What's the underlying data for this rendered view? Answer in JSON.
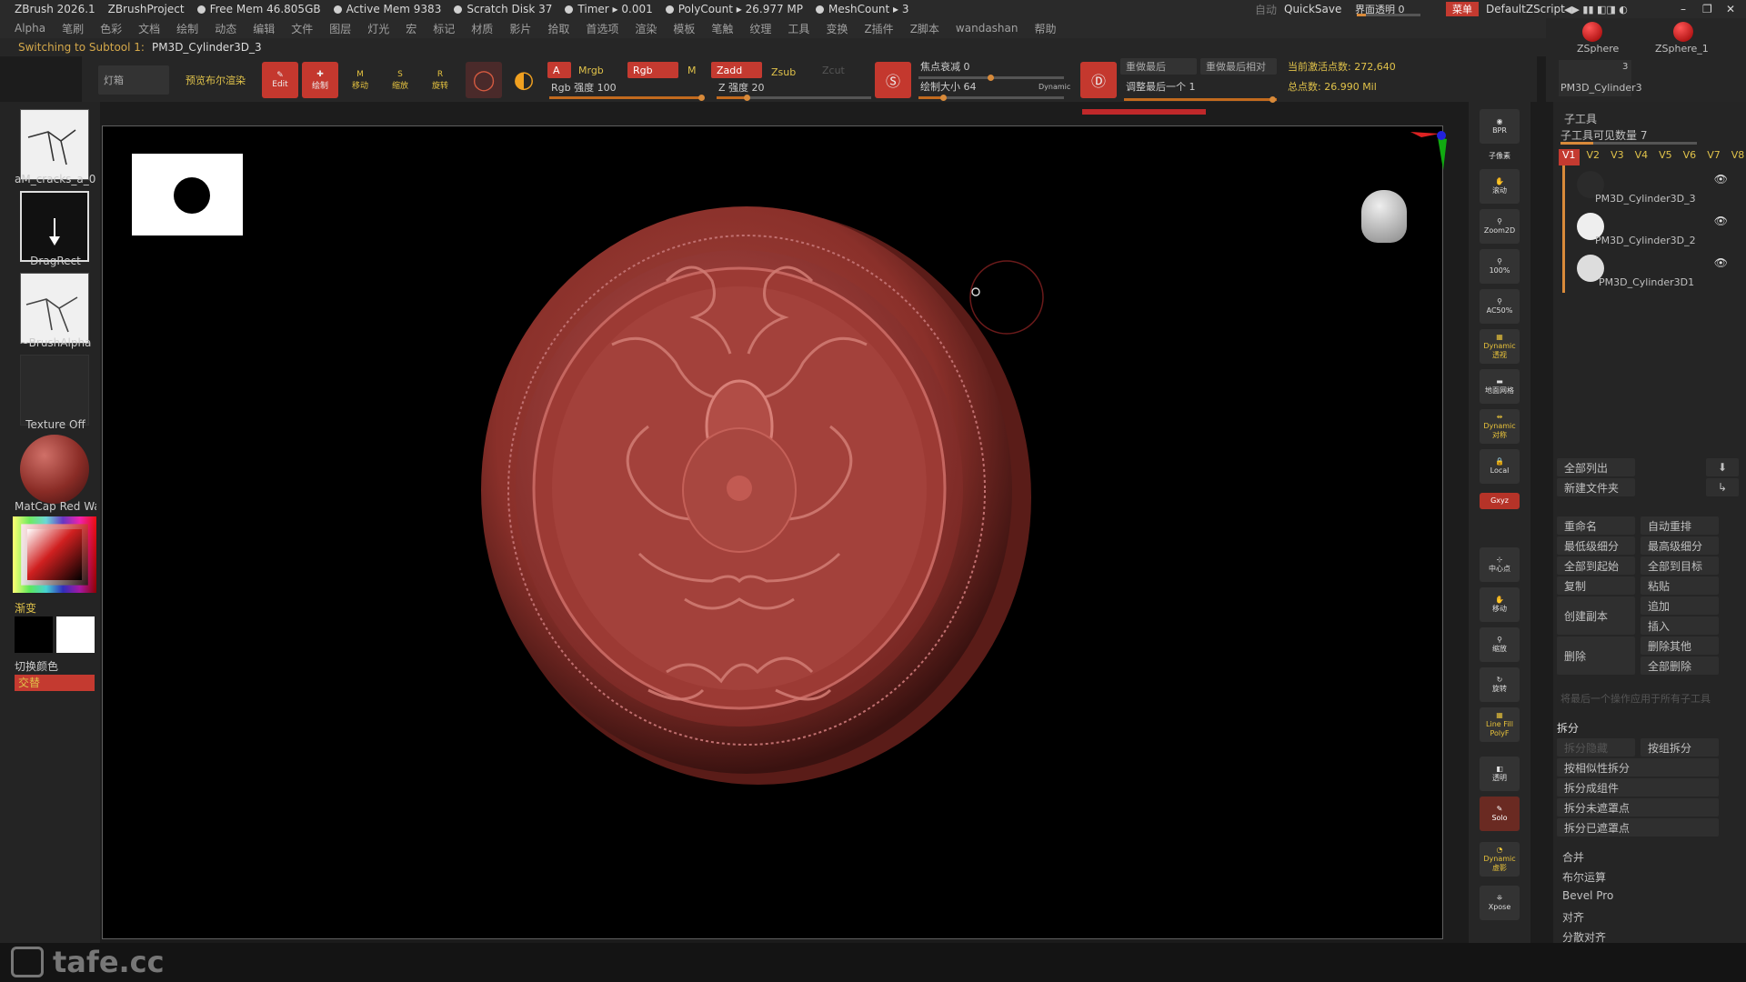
{
  "titlebar": {
    "app": "ZBrush 2026.1",
    "project": "ZBrushProject",
    "free_mem": "Free Mem 46.805GB",
    "active_mem": "Active Mem 9383",
    "scratch": "Scratch Disk 37",
    "timer": "Timer ▸ 0.001",
    "polycount": "PolyCount ▸ 26.977 MP",
    "meshcount": "MeshCount ▸ 3",
    "auto": "自动",
    "quicksave": "QuickSave",
    "ui_opacity": "界面透明 0",
    "menus_btn": "菜单",
    "script": "DefaultZScript"
  },
  "menus": [
    "Alpha",
    "笔刷",
    "色彩",
    "文档",
    "绘制",
    "动态",
    "编辑",
    "文件",
    "图层",
    "灯光",
    "宏",
    "标记",
    "材质",
    "影片",
    "拾取",
    "首选项",
    "渲染",
    "模板",
    "笔触",
    "纹理",
    "工具",
    "变换",
    "Z插件",
    "Z脚本",
    "wandashan",
    "帮助"
  ],
  "notice": {
    "label": "Switching to Subtool 1:",
    "subtool": "PM3D_Cylinder3D_3"
  },
  "toolbar": {
    "lightbox": "灯箱",
    "preview_bpr": "预览布尔渲染",
    "edit": "Edit",
    "draw": "绘制",
    "move": "移动",
    "scale": "缩放",
    "rotate": "旋转",
    "a": "A",
    "mrgb": "Mrgb",
    "rgb": "Rgb",
    "m": "M",
    "zadd": "Zadd",
    "zsub": "Zsub",
    "zcut": "Zcut",
    "rgb_intensity": "Rgb 强度 100",
    "z_intensity": "Z 强度 20",
    "focal_shift": "焦点衰减 0",
    "draw_size": "绘制大小 64",
    "dynamic": "Dynamic",
    "redo_last": "重做最后",
    "redo_last_rel": "重做最后相对",
    "adjust_last": "调整最后一个 1",
    "active_points": "当前激活点数: 272,640",
    "total_points": "总点数: 26.990 Mil"
  },
  "leftshelf": {
    "brush_alpha": "aM_cracks_a_0",
    "stroke": "DragRect",
    "alpha": "~BrushAlpha",
    "texture": "Texture Off",
    "material": "MatCap Red Wax",
    "gradient": "渐变",
    "switch_color": "切换颜色",
    "alternate": "交替"
  },
  "rightshelf": [
    "BPR",
    "子像素",
    "滚动",
    "Zoom2D",
    "100%",
    "AC50%",
    "Dynamic 透视",
    "地面网格",
    "Dynamic 对称",
    "Local",
    "Gxyz",
    "中心点",
    "移动",
    "缩放",
    "旋转",
    "Line Fill PolyF",
    "透明",
    "Solo",
    "Dynamic 虚影",
    "Xpose"
  ],
  "tool": {
    "zsphere": "ZSphere",
    "zsphere1": "ZSphere_1",
    "count": "3",
    "current": "PM3D_Cylinder3"
  },
  "subtool": {
    "title": "子工具",
    "visible_count": "子工具可见数量 7",
    "versions": [
      "V1",
      "V2",
      "V3",
      "V4",
      "V5",
      "V6",
      "V7",
      "V8"
    ],
    "items": [
      "PM3D_Cylinder3D_3",
      "PM3D_Cylinder3D_2",
      "PM3D_Cylinder3D1"
    ]
  },
  "palette": {
    "list_all": "全部列出",
    "new_folder": "新建文件夹",
    "rename": "重命名",
    "auto_reorder": "自动重排",
    "lowest_sub": "最低级细分",
    "highest_sub": "最高级细分",
    "all_to_start": "全部到起始",
    "all_to_target": "全部到目标",
    "copy": "复制",
    "paste": "粘贴",
    "duplicate": "创建副本",
    "append": "追加",
    "insert": "插入",
    "delete": "删除",
    "delete_other": "删除其他",
    "delete_all": "全部删除",
    "apply_note": "将最后一个操作应用于所有子工具",
    "split": "拆分",
    "split_hidden": "拆分隐藏",
    "groups_split": "按组拆分",
    "similar_split": "按相似性拆分",
    "split_parts": "拆分成组件",
    "split_unmasked": "拆分未遮罩点",
    "split_masked": "拆分已遮罩点",
    "merge": "合并",
    "boolean": "布尔运算",
    "bevel_pro": "Bevel Pro",
    "align": "对齐",
    "distribute": "分散对齐"
  },
  "watermark": "tafe.cc",
  "colors": {
    "accent": "#c43a30",
    "clay": "#9e3a34",
    "orange": "#d88a3a"
  }
}
